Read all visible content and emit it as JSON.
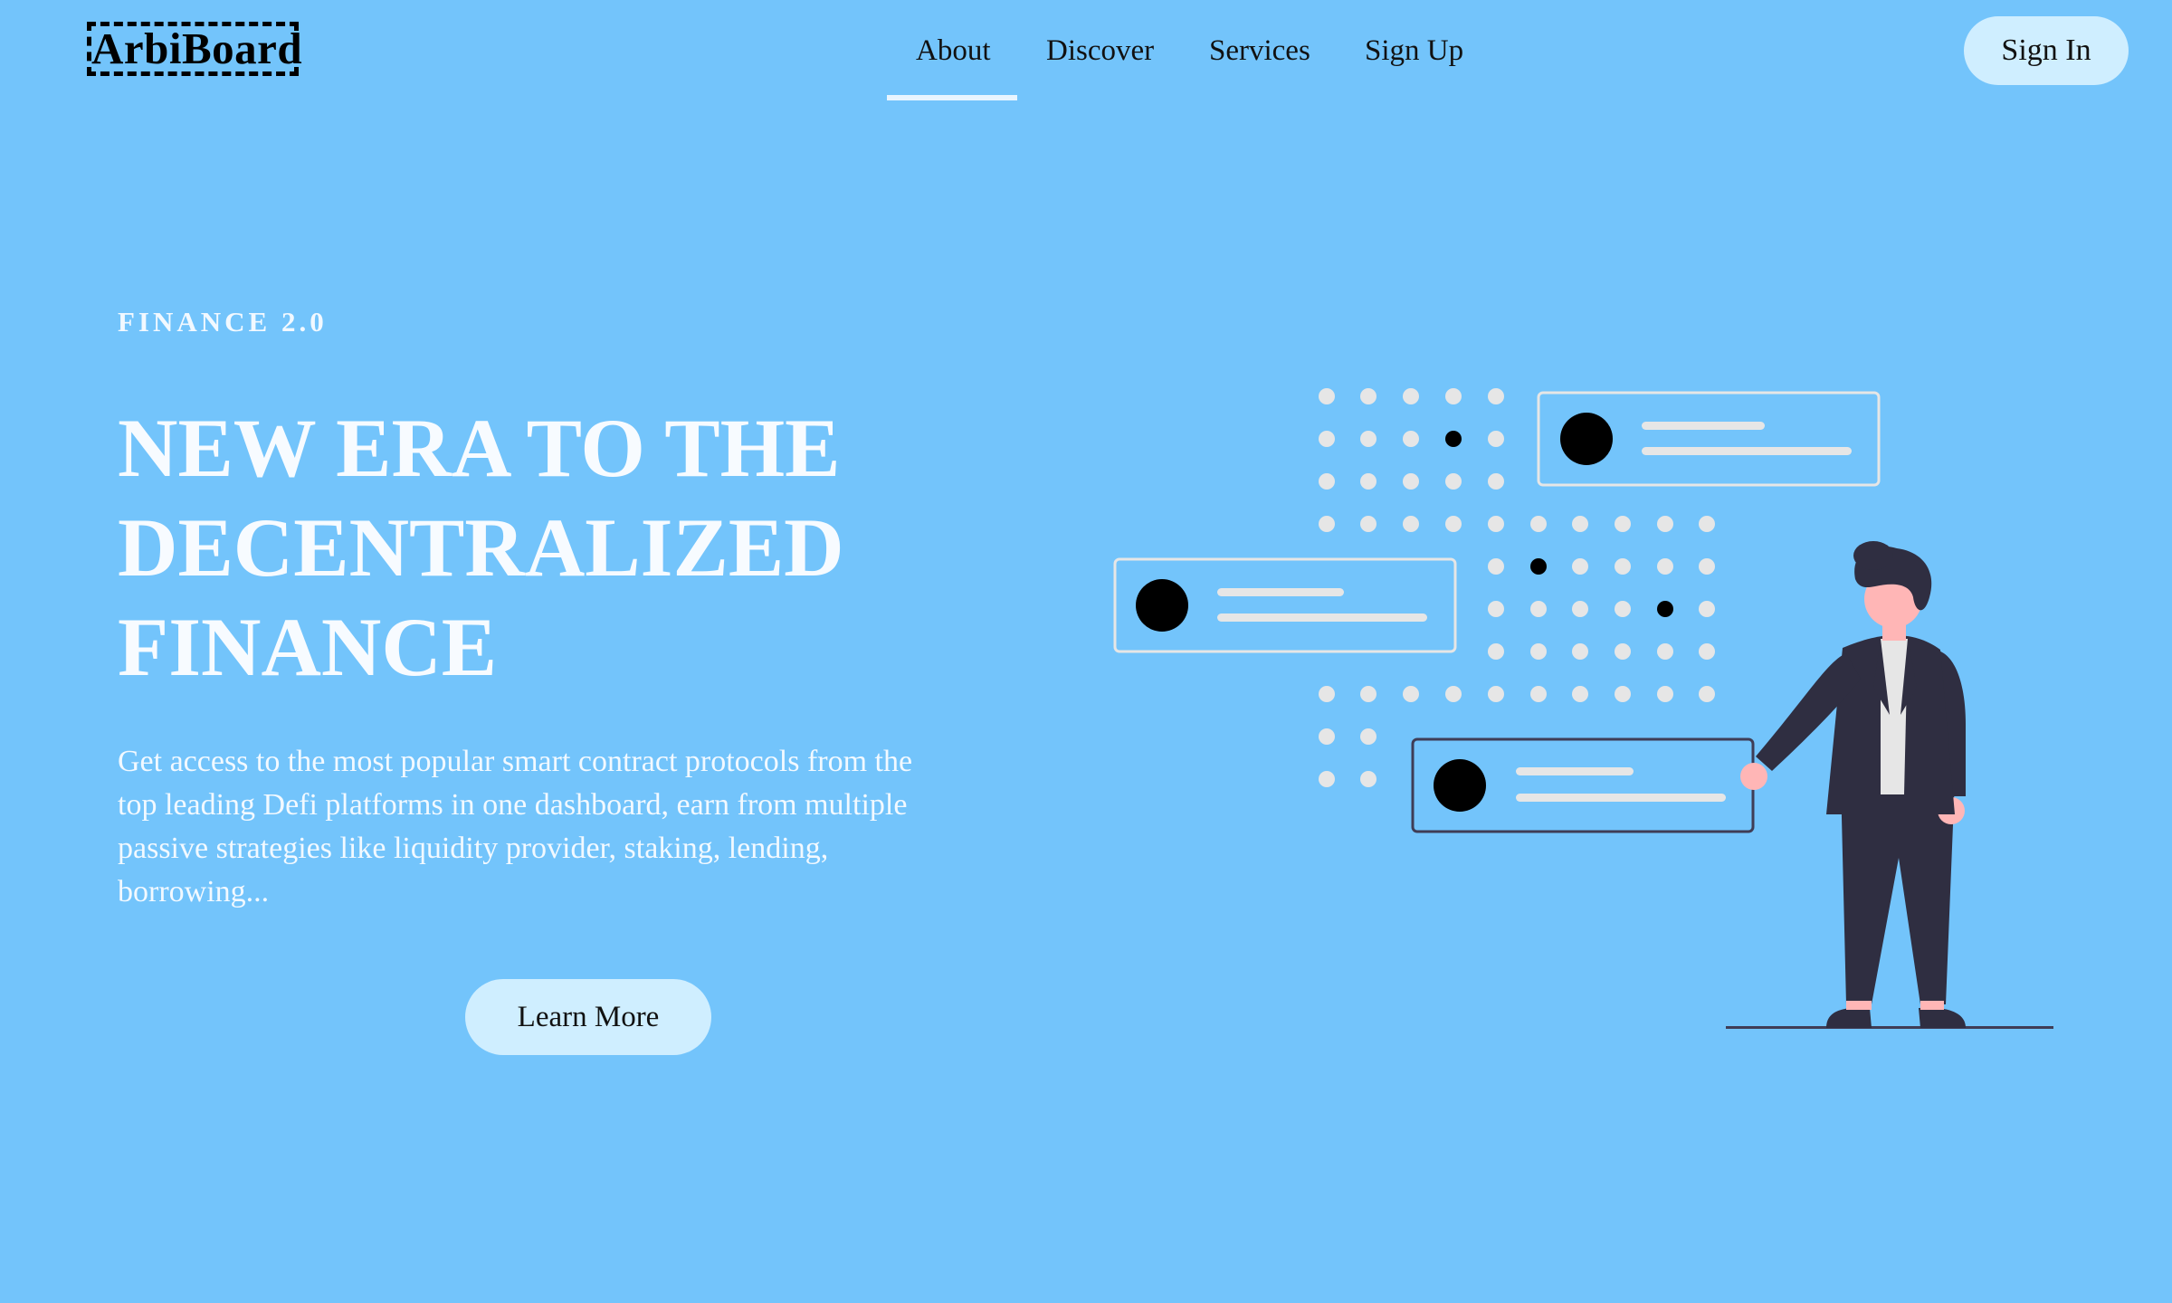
{
  "brand": {
    "logo_text": "ArbiBoard"
  },
  "nav": {
    "items": [
      {
        "label": "About",
        "active": true
      },
      {
        "label": "Discover"
      },
      {
        "label": "Services"
      },
      {
        "label": "Sign Up"
      }
    ],
    "signin_label": "Sign In"
  },
  "hero": {
    "eyebrow": "FINANCE 2.0",
    "headline": "NEW ERA TO THE DECENTRALIZED FINANCE",
    "description": "Get access to the most popular smart contract protocols from the top leading Defi platforms in one dashboard, earn from multiple passive strategies like liquidity provider, staking, lending, borrowing...",
    "cta_label": "Learn More"
  },
  "colors": {
    "background": "#73c4fb",
    "button": "#cfeeff",
    "dots": "#e6e6e6",
    "figure_suit": "#2f2e41",
    "skin": "#ffb6b6"
  },
  "illustration": {
    "icon": "person-with-dashboard-cards-illustration"
  }
}
